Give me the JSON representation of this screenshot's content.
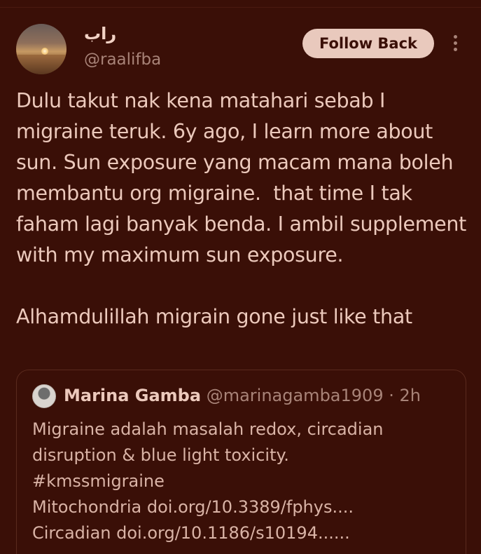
{
  "author": {
    "display_name": "راب",
    "handle": "@raalifba"
  },
  "actions": {
    "follow_label": "Follow Back"
  },
  "tweet": {
    "text": "Dulu takut nak kena matahari sebab I migraine teruk. 6y ago, I learn more about sun. Sun exposure yang macam mana boleh membantu org migraine.  that time I tak faham lagi banyak benda. I ambil supplement with my maximum sun exposure.\n\nAlhamdulillah migrain gone just like that"
  },
  "quoted": {
    "name": "Marina Gamba",
    "handle": "@marinagamba1909",
    "separator": " · ",
    "time": "2h",
    "text": "Migraine adalah masalah redox, circadian disruption & blue light toxicity.\n#kmssmigraine\nMitochondria doi.org/10.3389/fphys....\nCircadian doi.org/10.1186/s10194......"
  },
  "icons": {
    "more": "more-vertical-icon"
  },
  "colors": {
    "background": "#3a0f07",
    "text": "#ecc9bc",
    "muted": "#a88378",
    "button_bg": "#e9c9bd"
  }
}
